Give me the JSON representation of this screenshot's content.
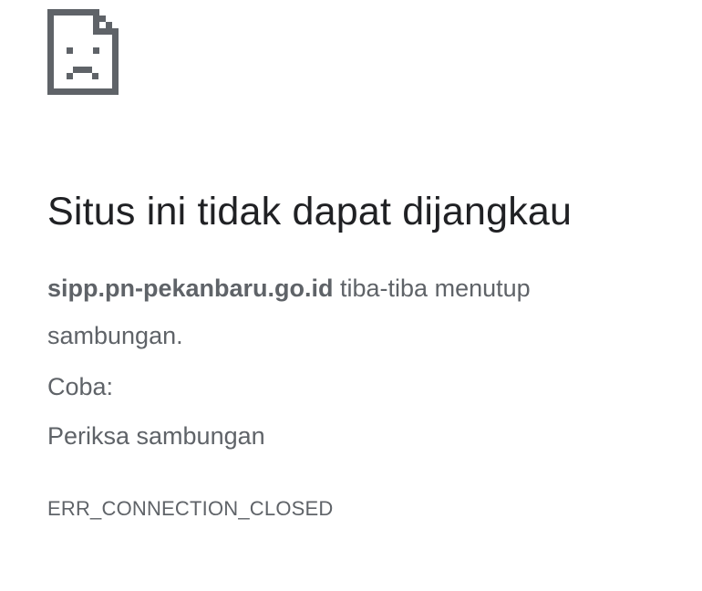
{
  "icon": {
    "name": "sad-page-icon",
    "color": "#5f6368"
  },
  "error": {
    "title": "Situs ini tidak dapat dijangkau",
    "host": "sipp.pn-pekanbaru.go.id",
    "message_rest": " tiba-tiba menutup sambungan.",
    "try_label": "Coba:",
    "suggestion": "Periksa sambungan",
    "code": "ERR_CONNECTION_CLOSED"
  },
  "colors": {
    "title": "#202124",
    "body_text": "#5f6368",
    "background": "#ffffff"
  }
}
